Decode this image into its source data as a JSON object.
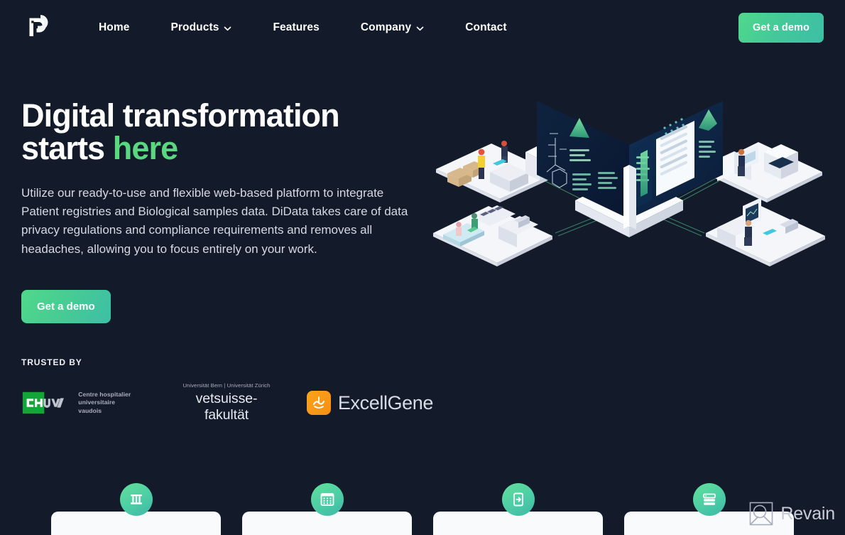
{
  "brand": {
    "logo_icon": "didata-logo-icon",
    "accent_green": "#5AD87F",
    "button_gradient_from": "#4FD98A",
    "button_gradient_to": "#3DBFA6",
    "background": "#131A2A"
  },
  "nav": {
    "items": [
      {
        "label": "Home",
        "has_dropdown": false
      },
      {
        "label": "Products",
        "has_dropdown": true,
        "icon": "chevron-down-icon"
      },
      {
        "label": "Features",
        "has_dropdown": false
      },
      {
        "label": "Company",
        "has_dropdown": true,
        "icon": "chevron-down-icon"
      },
      {
        "label": "Contact",
        "has_dropdown": false
      }
    ],
    "cta_label": "Get a demo"
  },
  "hero": {
    "title_line1": "Digital transformation",
    "title_line2_plain": "starts ",
    "title_line2_accent": "here",
    "paragraph": "Utilize our ready-to-use and flexible web-based platform to integrate Patient registries and Biological samples data. DiData takes care of data privacy regulations and compliance requirements and removes all headaches, allowing you to focus entirely on your work.",
    "cta_label": "Get a demo",
    "illustration_name": "isometric-data-platform-illustration"
  },
  "trusted": {
    "label": "TRUSTED BY",
    "logos": [
      {
        "name": "chuv-logo",
        "mark_text": "CHUV",
        "text_line1": "Centre hospitalier",
        "text_line2": "universitaire vaudois",
        "mark_color": "#13A538"
      },
      {
        "name": "vetsuisse-logo",
        "top_line": "Universität Bern | Universität Zürich",
        "main_line": "vetsuisse-fakultät"
      },
      {
        "name": "excellgene-logo",
        "mark_color": "#F89B16",
        "name_text": "ExcellGene"
      }
    ]
  },
  "feature_cards": [
    {
      "icon": "test-tube-rack-icon"
    },
    {
      "icon": "microplate-grid-icon"
    },
    {
      "icon": "document-page-icon"
    },
    {
      "icon": "server-database-icon"
    }
  ],
  "watermark": {
    "icon": "revain-logo-icon",
    "text": "Revain"
  }
}
